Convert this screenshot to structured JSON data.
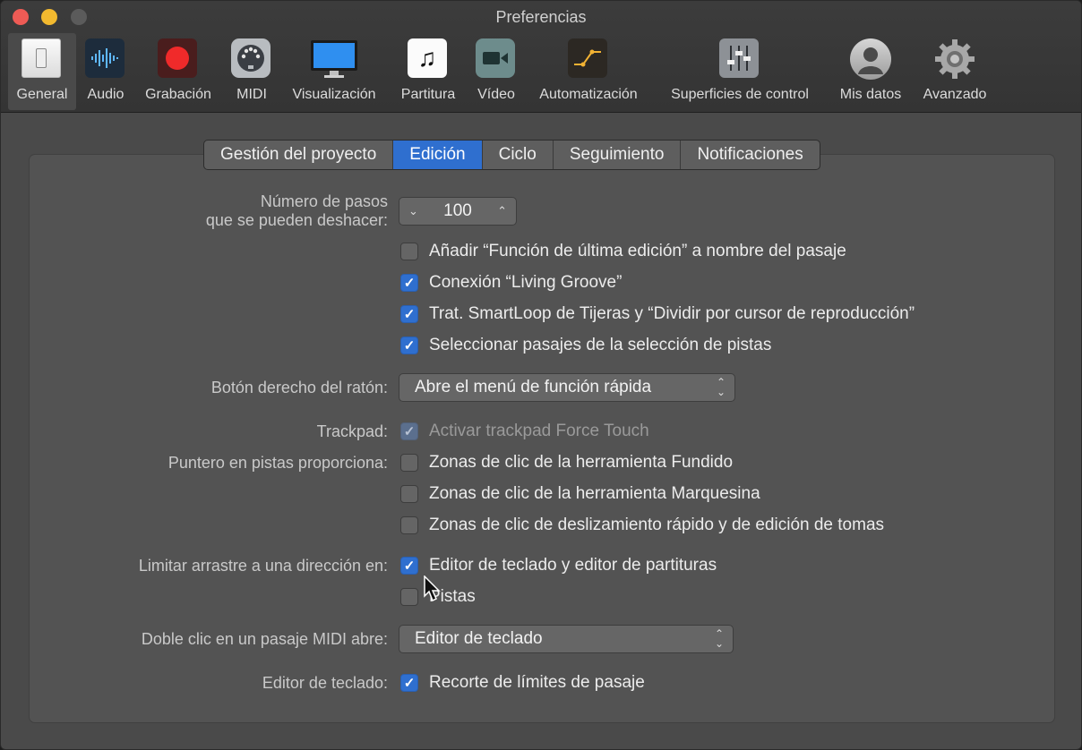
{
  "window": {
    "title": "Preferencias"
  },
  "toolbar": {
    "items": [
      {
        "label": "General",
        "icon": "general-icon",
        "selected": true
      },
      {
        "label": "Audio",
        "icon": "audio-waveform-icon"
      },
      {
        "label": "Grabación",
        "icon": "record-icon"
      },
      {
        "label": "MIDI",
        "icon": "midi-connector-icon"
      },
      {
        "label": "Visualización",
        "icon": "display-icon"
      },
      {
        "label": "Partitura",
        "icon": "music-note-icon"
      },
      {
        "label": "Vídeo",
        "icon": "video-camera-icon"
      },
      {
        "label": "Automatización",
        "icon": "automation-curve-icon"
      },
      {
        "label": "Superficies de control",
        "icon": "faders-icon"
      },
      {
        "label": "Mis datos",
        "icon": "user-silhouette-icon"
      },
      {
        "label": "Avanzado",
        "icon": "gear-icon"
      }
    ]
  },
  "tabs": [
    {
      "label": "Gestión del proyecto"
    },
    {
      "label": "Edición",
      "active": true
    },
    {
      "label": "Ciclo"
    },
    {
      "label": "Seguimiento"
    },
    {
      "label": "Notificaciones"
    }
  ],
  "undo": {
    "label_line1": "Número de pasos",
    "label_line2": "que se pueden deshacer:",
    "value": "100"
  },
  "options": {
    "add_last_edit": {
      "label": "Añadir “Función de última edición” a nombre del pasaje",
      "checked": false
    },
    "living_groove": {
      "label": "Conexión “Living Groove”",
      "checked": true
    },
    "smartloop": {
      "label": "Trat. SmartLoop de Tijeras y “Dividir por cursor de reproducción”",
      "checked": true
    },
    "select_regions": {
      "label": "Seleccionar pasajes de la selección de pistas",
      "checked": true
    }
  },
  "right_mouse": {
    "label": "Botón derecho del ratón:",
    "value": "Abre el menú de función rápida"
  },
  "trackpad": {
    "label": "Trackpad:",
    "option": "Activar trackpad Force Touch",
    "checked": true,
    "enabled": false
  },
  "pointer": {
    "label": "Puntero en pistas proporciona:",
    "items": [
      {
        "label": "Zonas de clic de la herramienta Fundido",
        "checked": false
      },
      {
        "label": "Zonas de clic de la herramienta Marquesina",
        "checked": false
      },
      {
        "label": "Zonas de clic de deslizamiento rápido y de edición de tomas",
        "checked": false
      }
    ]
  },
  "limit_drag": {
    "label": "Limitar arrastre a una dirección en:",
    "items": [
      {
        "label": "Editor de teclado y editor de partituras",
        "checked": true
      },
      {
        "label": "Pistas",
        "checked": false
      }
    ]
  },
  "double_click": {
    "label": "Doble clic en un pasaje MIDI abre:",
    "value": "Editor de teclado"
  },
  "piano_roll": {
    "label": "Editor de teclado:",
    "option": "Recorte de límites de pasaje",
    "checked": true
  }
}
